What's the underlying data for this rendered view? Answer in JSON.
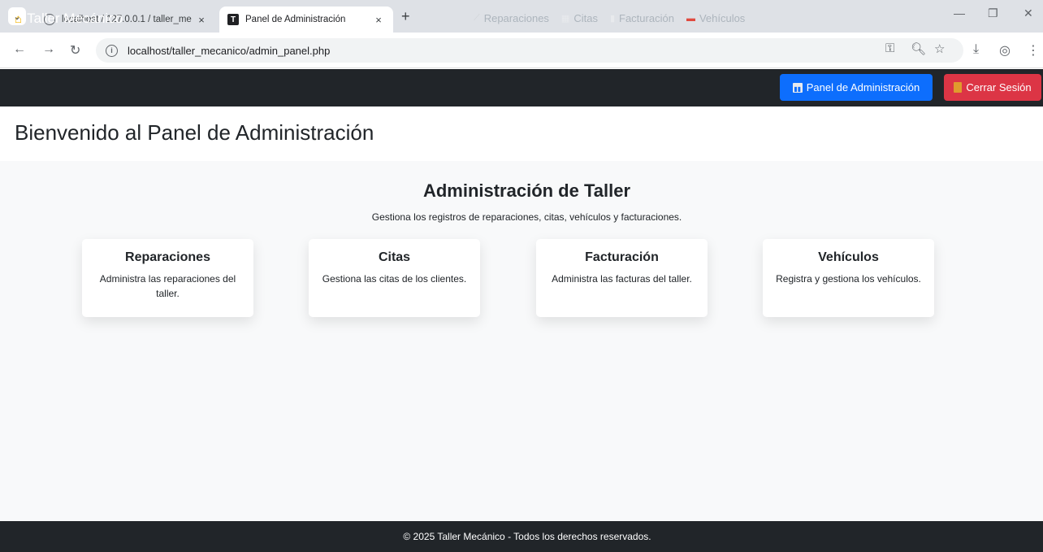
{
  "browser": {
    "tabs": [
      {
        "title": "localhost / 127.0.0.1 / taller_me",
        "close": "×"
      },
      {
        "title": "Panel de Administración",
        "close": "×"
      }
    ],
    "new_tab": "+",
    "menu_chevron": "⌄",
    "url": "localhost/taller_mecanico/admin_panel.php",
    "window_controls": {
      "minimize": "—",
      "restore": "❐",
      "close": "✕"
    }
  },
  "navbar": {
    "brand": "Taller Mecánico",
    "links": [
      {
        "label": "Reparaciones",
        "icon": "wrench-icon"
      },
      {
        "label": "Citas",
        "icon": "calendar-icon"
      },
      {
        "label": "Facturación",
        "icon": "receipt-icon"
      },
      {
        "label": "Vehículos",
        "icon": "car-icon"
      }
    ],
    "admin_button": "Panel de Administración",
    "logout_button": "Cerrar Sesión"
  },
  "page": {
    "title": "Bienvenido al Panel de Administración",
    "section_title": "Administración de Taller",
    "section_subtitle": "Gestiona los registros de reparaciones, citas, vehículos y facturaciones."
  },
  "cards": [
    {
      "title": "Reparaciones",
      "text": "Administra las reparaciones del taller."
    },
    {
      "title": "Citas",
      "text": "Gestiona las citas de los clientes."
    },
    {
      "title": "Facturación",
      "text": "Administra las facturas del taller."
    },
    {
      "title": "Vehículos",
      "text": "Registra y gestiona los vehículos."
    }
  ],
  "footer": {
    "text": "© 2025 Taller Mecánico - Todos los derechos reservados."
  },
  "colors": {
    "navbar": "#212529",
    "primary": "#0d6efd",
    "danger": "#dc3545",
    "panel_bg": "#f8f9fa"
  }
}
